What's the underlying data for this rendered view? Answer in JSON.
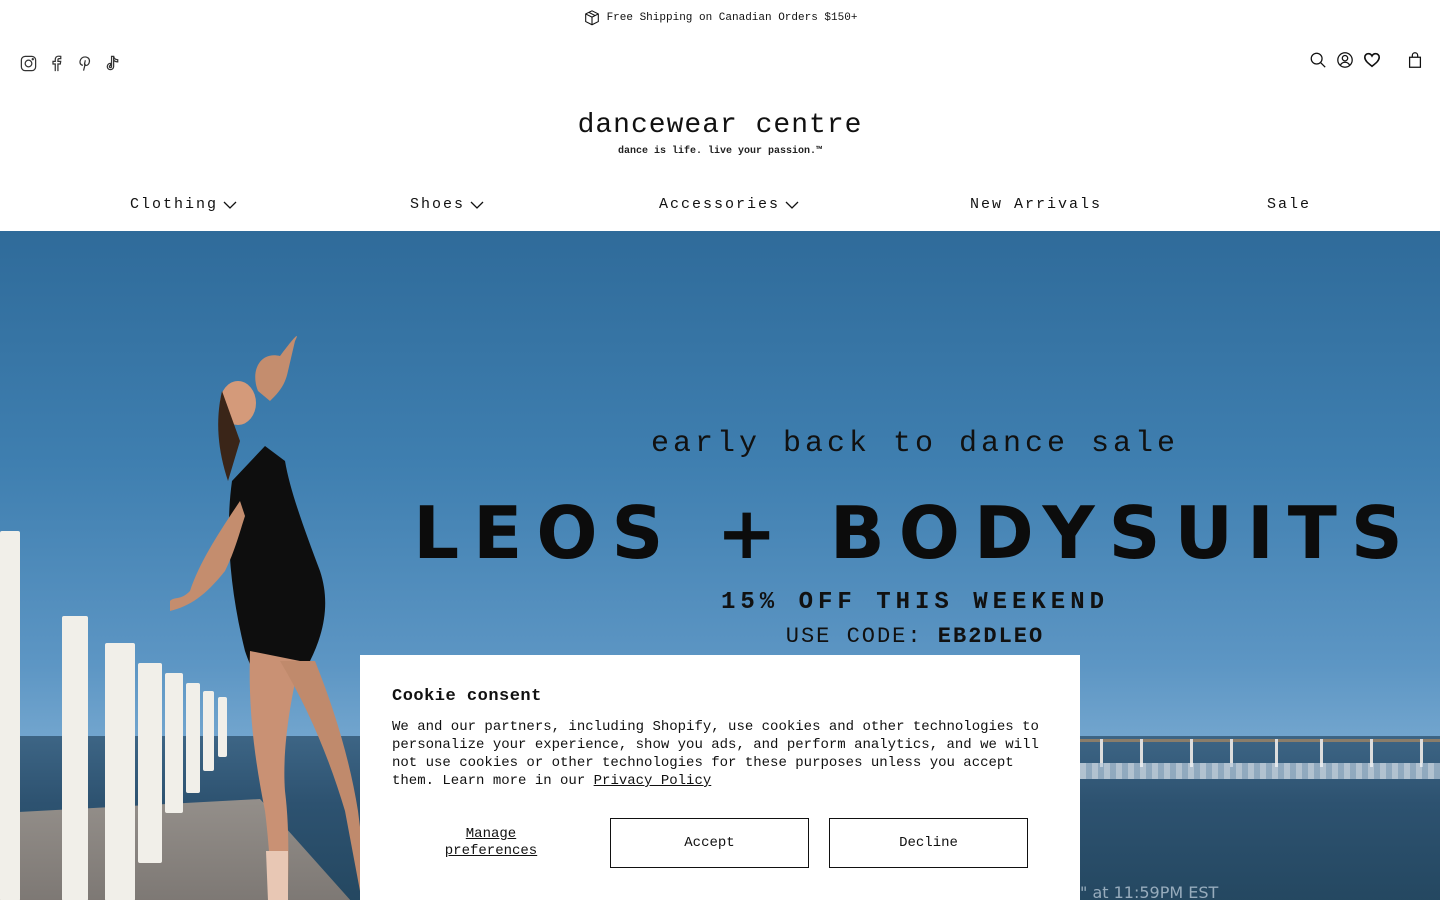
{
  "announcement": {
    "text": "Free Shipping on Canadian Orders $150+",
    "icon": "box-icon"
  },
  "social": [
    "instagram-icon",
    "facebook-icon",
    "pinterest-icon",
    "tiktok-icon"
  ],
  "utilities": [
    "search-icon",
    "account-icon",
    "wishlist-icon",
    "cart-icon"
  ],
  "logo": {
    "brand": "dancewear centre",
    "tagline": "dance is life. live your passion.™"
  },
  "nav": {
    "items": [
      {
        "label": "Clothing",
        "dropdown": true
      },
      {
        "label": "Shoes",
        "dropdown": true
      },
      {
        "label": "Accessories",
        "dropdown": true
      },
      {
        "label": "New Arrivals",
        "dropdown": false
      },
      {
        "label": "Sale",
        "dropdown": false
      }
    ]
  },
  "hero": {
    "subheading": "early back to dance sale",
    "heading": "LEOS + BODYSUITS",
    "offer": "15% OFF THIS WEEKEND",
    "code_prefix": "USE CODE:",
    "code": "EB2DLEO",
    "fine_print": "\" at 11:59PM EST",
    "colors": {
      "sky": "#3f7fb0",
      "text": "#111111"
    }
  },
  "cookie": {
    "title": "Cookie consent",
    "body": "We and our partners, including Shopify, use cookies and other technologies to personalize your experience, show you ads, and perform analytics, and we will not use cookies or other technologies for these purposes unless you accept them. Learn more in our",
    "policy_link": "Privacy Policy",
    "manage_label": "Manage preferences",
    "accept_label": "Accept",
    "decline_label": "Decline"
  }
}
